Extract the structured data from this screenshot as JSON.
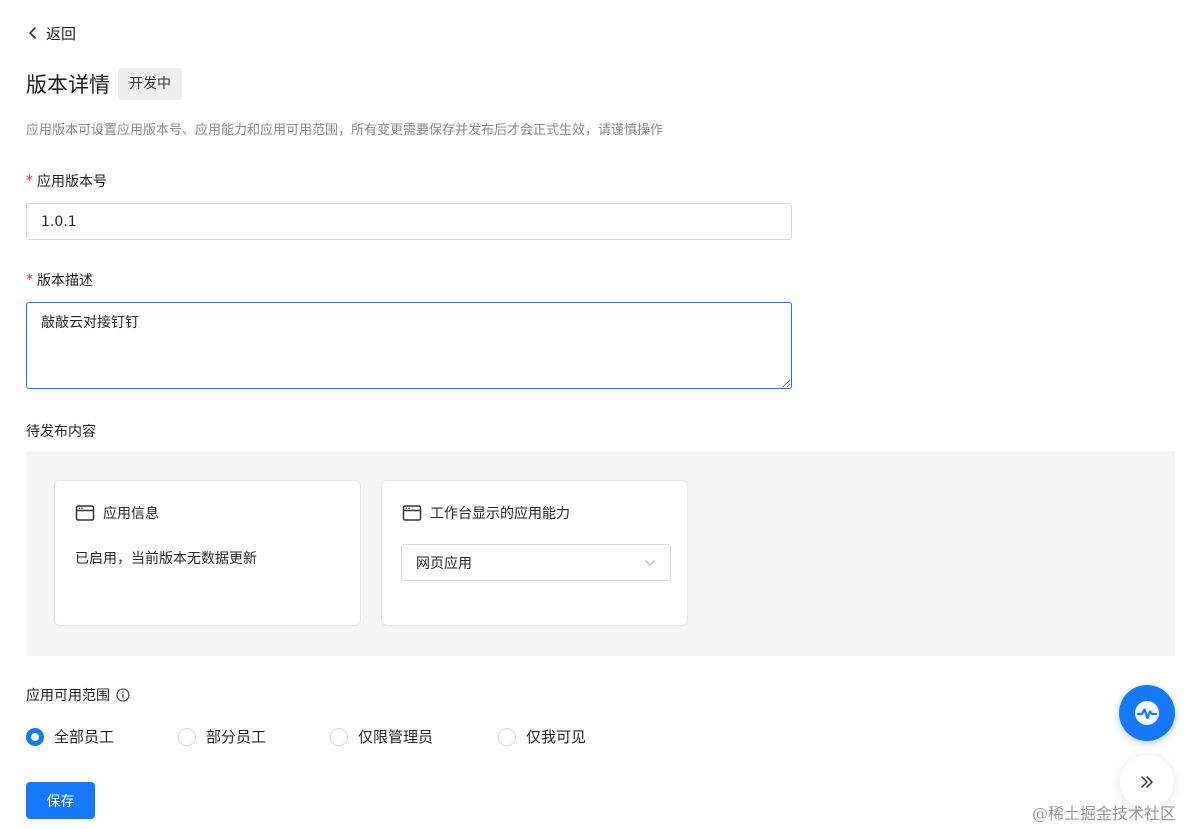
{
  "nav": {
    "back_label": "返回",
    "back_icon": "chevron-left-icon"
  },
  "header": {
    "title": "版本详情",
    "status_badge": "开发中",
    "description": "应用版本可设置应用版本号、应用能力和应用可用范围，所有变更需要保存并发布后才会正式生效，请谨慎操作"
  },
  "form": {
    "required_mark": "*",
    "version_label": "应用版本号",
    "version_value": "1.0.1",
    "desc_label": "版本描述",
    "desc_value": "敲敲云对接钉钉"
  },
  "pending": {
    "section_label": "待发布内容",
    "cards": [
      {
        "icon": "window-icon",
        "title": "应用信息",
        "text": "已启用，当前版本无数据更新"
      },
      {
        "icon": "window-icon",
        "title": "工作台显示的应用能力",
        "select_value": "网页应用"
      }
    ]
  },
  "scope": {
    "label": "应用可用范围",
    "info_icon": "info-icon",
    "options": [
      {
        "label": "全部员工",
        "checked": true
      },
      {
        "label": "部分员工",
        "checked": false
      },
      {
        "label": "仅限管理员",
        "checked": false
      },
      {
        "label": "仅我可见",
        "checked": false
      }
    ]
  },
  "actions": {
    "save_label": "保存"
  },
  "floating": {
    "help_icon": "assistant-icon",
    "expand_icon": "double-chevron-right-icon"
  },
  "watermark": "@稀土掘金技术社区",
  "colors": {
    "primary": "#1677ff",
    "required": "#f5222d",
    "panel_bg": "#f5f5f5",
    "badge_bg": "#eeeeee"
  }
}
